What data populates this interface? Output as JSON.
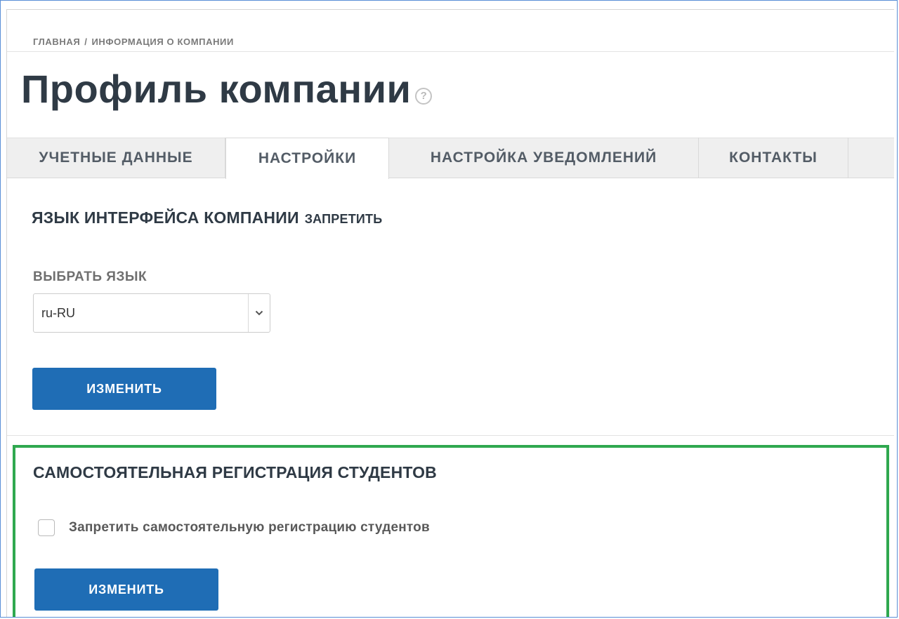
{
  "breadcrumb": {
    "home": "ГЛАВНАЯ",
    "separator": "/",
    "current": "ИНФОРМАЦИЯ О КОМПАНИИ"
  },
  "page": {
    "title": "Профиль компании",
    "help_icon_glyph": "?"
  },
  "tabs": [
    {
      "label": "УЧЕТНЫЕ ДАННЫЕ",
      "active": false
    },
    {
      "label": "НАСТРОЙКИ",
      "active": true
    },
    {
      "label": "НАСТРОЙКА УВЕДОМЛЕНИЙ",
      "active": false
    },
    {
      "label": "КОНТАКТЫ",
      "active": false
    }
  ],
  "language_section": {
    "title": "ЯЗЫК ИНТЕРФЕЙСА КОМПАНИИ",
    "forbid_link": "ЗАПРЕТИТЬ",
    "select_label": "ВЫБРАТЬ ЯЗЫК",
    "selected_language": "ru-RU",
    "submit_label": "ИЗМЕНИТЬ"
  },
  "registration_section": {
    "title": "САМОСТОЯТЕЛЬНАЯ РЕГИСТРАЦИЯ  СТУДЕНТОВ",
    "checkbox_label": "Запретить самостоятельную регистрацию студентов",
    "checkbox_checked": false,
    "submit_label": "ИЗМЕНИТЬ",
    "highlight_color": "#2fa84f"
  },
  "colors": {
    "primary_button": "#1f6db5",
    "title_text": "#2f3a45"
  }
}
